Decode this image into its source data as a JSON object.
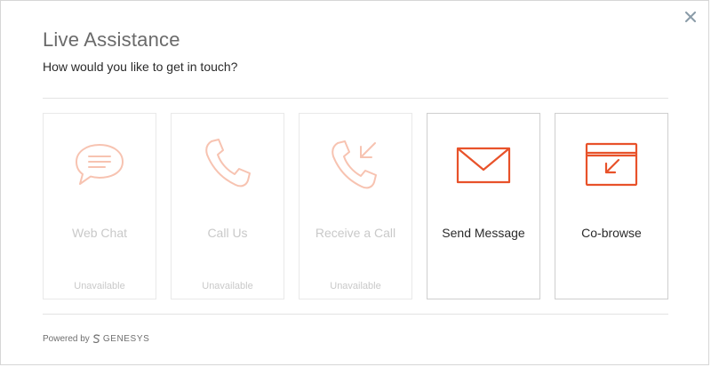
{
  "modal": {
    "title": "Live Assistance",
    "subtitle": "How would you like to get in touch?",
    "close_icon": "close-icon"
  },
  "options": [
    {
      "label": "Web Chat",
      "status": "Unavailable",
      "icon": "chat-icon",
      "available": false
    },
    {
      "label": "Call Us",
      "status": "Unavailable",
      "icon": "phone-icon",
      "available": false
    },
    {
      "label": "Receive a Call",
      "status": "Unavailable",
      "icon": "incoming-call-icon",
      "available": false
    },
    {
      "label": "Send Message",
      "status": "",
      "icon": "envelope-icon",
      "available": true
    },
    {
      "label": "Co-browse",
      "status": "",
      "icon": "cobrowse-icon",
      "available": true
    }
  ],
  "footer": {
    "powered_by": "Powered by",
    "brand": "GENESYS",
    "logo_icon": "genesys-logo-icon"
  },
  "colors": {
    "accent": "#e8522a",
    "accent_muted": "#f7c3b1",
    "muted_text": "#c9c9c9",
    "border": "#e3e3e3"
  }
}
